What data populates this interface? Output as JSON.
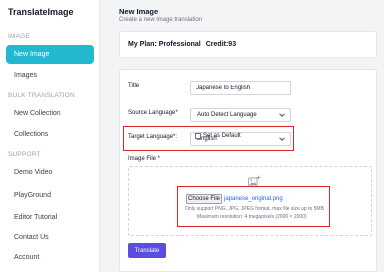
{
  "app": {
    "name": "TranslateImage"
  },
  "sidebar": {
    "sections": [
      {
        "label": "IMAGE",
        "items": [
          {
            "label": "New Image",
            "active": true
          },
          {
            "label": "Images"
          }
        ]
      },
      {
        "label": "BULK TRANSLATION",
        "items": [
          {
            "label": "New Collection"
          },
          {
            "label": "Collections"
          }
        ]
      },
      {
        "label": "SUPPORT",
        "items": [
          {
            "label": "Demo Video"
          },
          {
            "label": "PlayGround"
          },
          {
            "label": "Editor Tutorial"
          },
          {
            "label": "Contact Us"
          },
          {
            "label": "Account"
          }
        ]
      }
    ],
    "active_color": "#22b8cf"
  },
  "header": {
    "title": "New Image",
    "subtitle": "Create a new image translation"
  },
  "plan": {
    "plan_text": "My Plan: Professional",
    "credit_text": "Credit:93"
  },
  "form": {
    "title_label": "Title",
    "title_value": "Japanese to English",
    "source_label": "Source Language*",
    "source_value": "Auto Detect Language",
    "target_label": "Target Language*:",
    "target_value": "English",
    "default_checkbox_label": "Set as Default",
    "default_checked": false,
    "image_label": "Image File *",
    "choose_file_label": "Choose File",
    "file_name": "japanese_original.png",
    "support_text": "Only support PNG, JPG, JPEG format, max file size up to 5MB",
    "resolution_text": "Maximum resolution: 4 megapixels (2000 × 2000)",
    "submit_label": "Translate"
  },
  "colors": {
    "accent": "#5b4de0",
    "highlight": "#dc2626",
    "link": "#2563eb"
  },
  "icons": {
    "upload": "image-upload-icon",
    "chevron": "chevron-down-icon"
  }
}
